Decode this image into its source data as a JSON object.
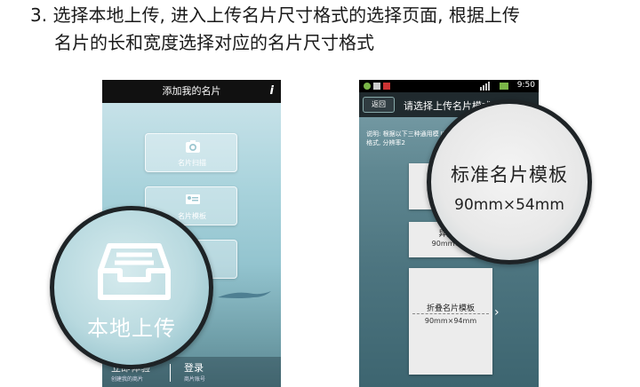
{
  "instruction": {
    "line1": "3. 选择本地上传, 进入上传名片尺寸格式的选择页面, 根据上传",
    "line2": "名片的长和宽度选择对应的名片尺寸格式"
  },
  "phone1": {
    "title": "添加我的名片",
    "info_icon": "i",
    "tiles": [
      {
        "label": "名片扫描",
        "icon": "camera-icon"
      },
      {
        "label": "名片模板",
        "icon": "card-template-icon"
      },
      {
        "label": "",
        "icon": ""
      }
    ],
    "bottom": {
      "left_label": "立即体验",
      "left_sub": "创建我的商片",
      "right_label": "登录",
      "right_sub": "商片账号"
    },
    "magnifier": {
      "label": "本地上传",
      "icon": "inbox-tray-icon"
    }
  },
  "phone2": {
    "status_time": "9:50",
    "back_label": "返回",
    "title": "请选择上传名片模式",
    "note": "说明: 根据以下三种通用模 JPG格式, 分辨率2",
    "cards": [
      {
        "name": "标",
        "size": "90"
      },
      {
        "name": "异形名",
        "size": "90mm×45"
      },
      {
        "name": "折叠名片模板",
        "size": "90mm×94mm"
      }
    ],
    "magnifier": {
      "name": "标准名片模板",
      "size": "90mm×54mm"
    }
  },
  "colors": {
    "title_bar": "#111111",
    "nav_bar": "#202a2e",
    "magnifier_rim": "#1e2326"
  }
}
